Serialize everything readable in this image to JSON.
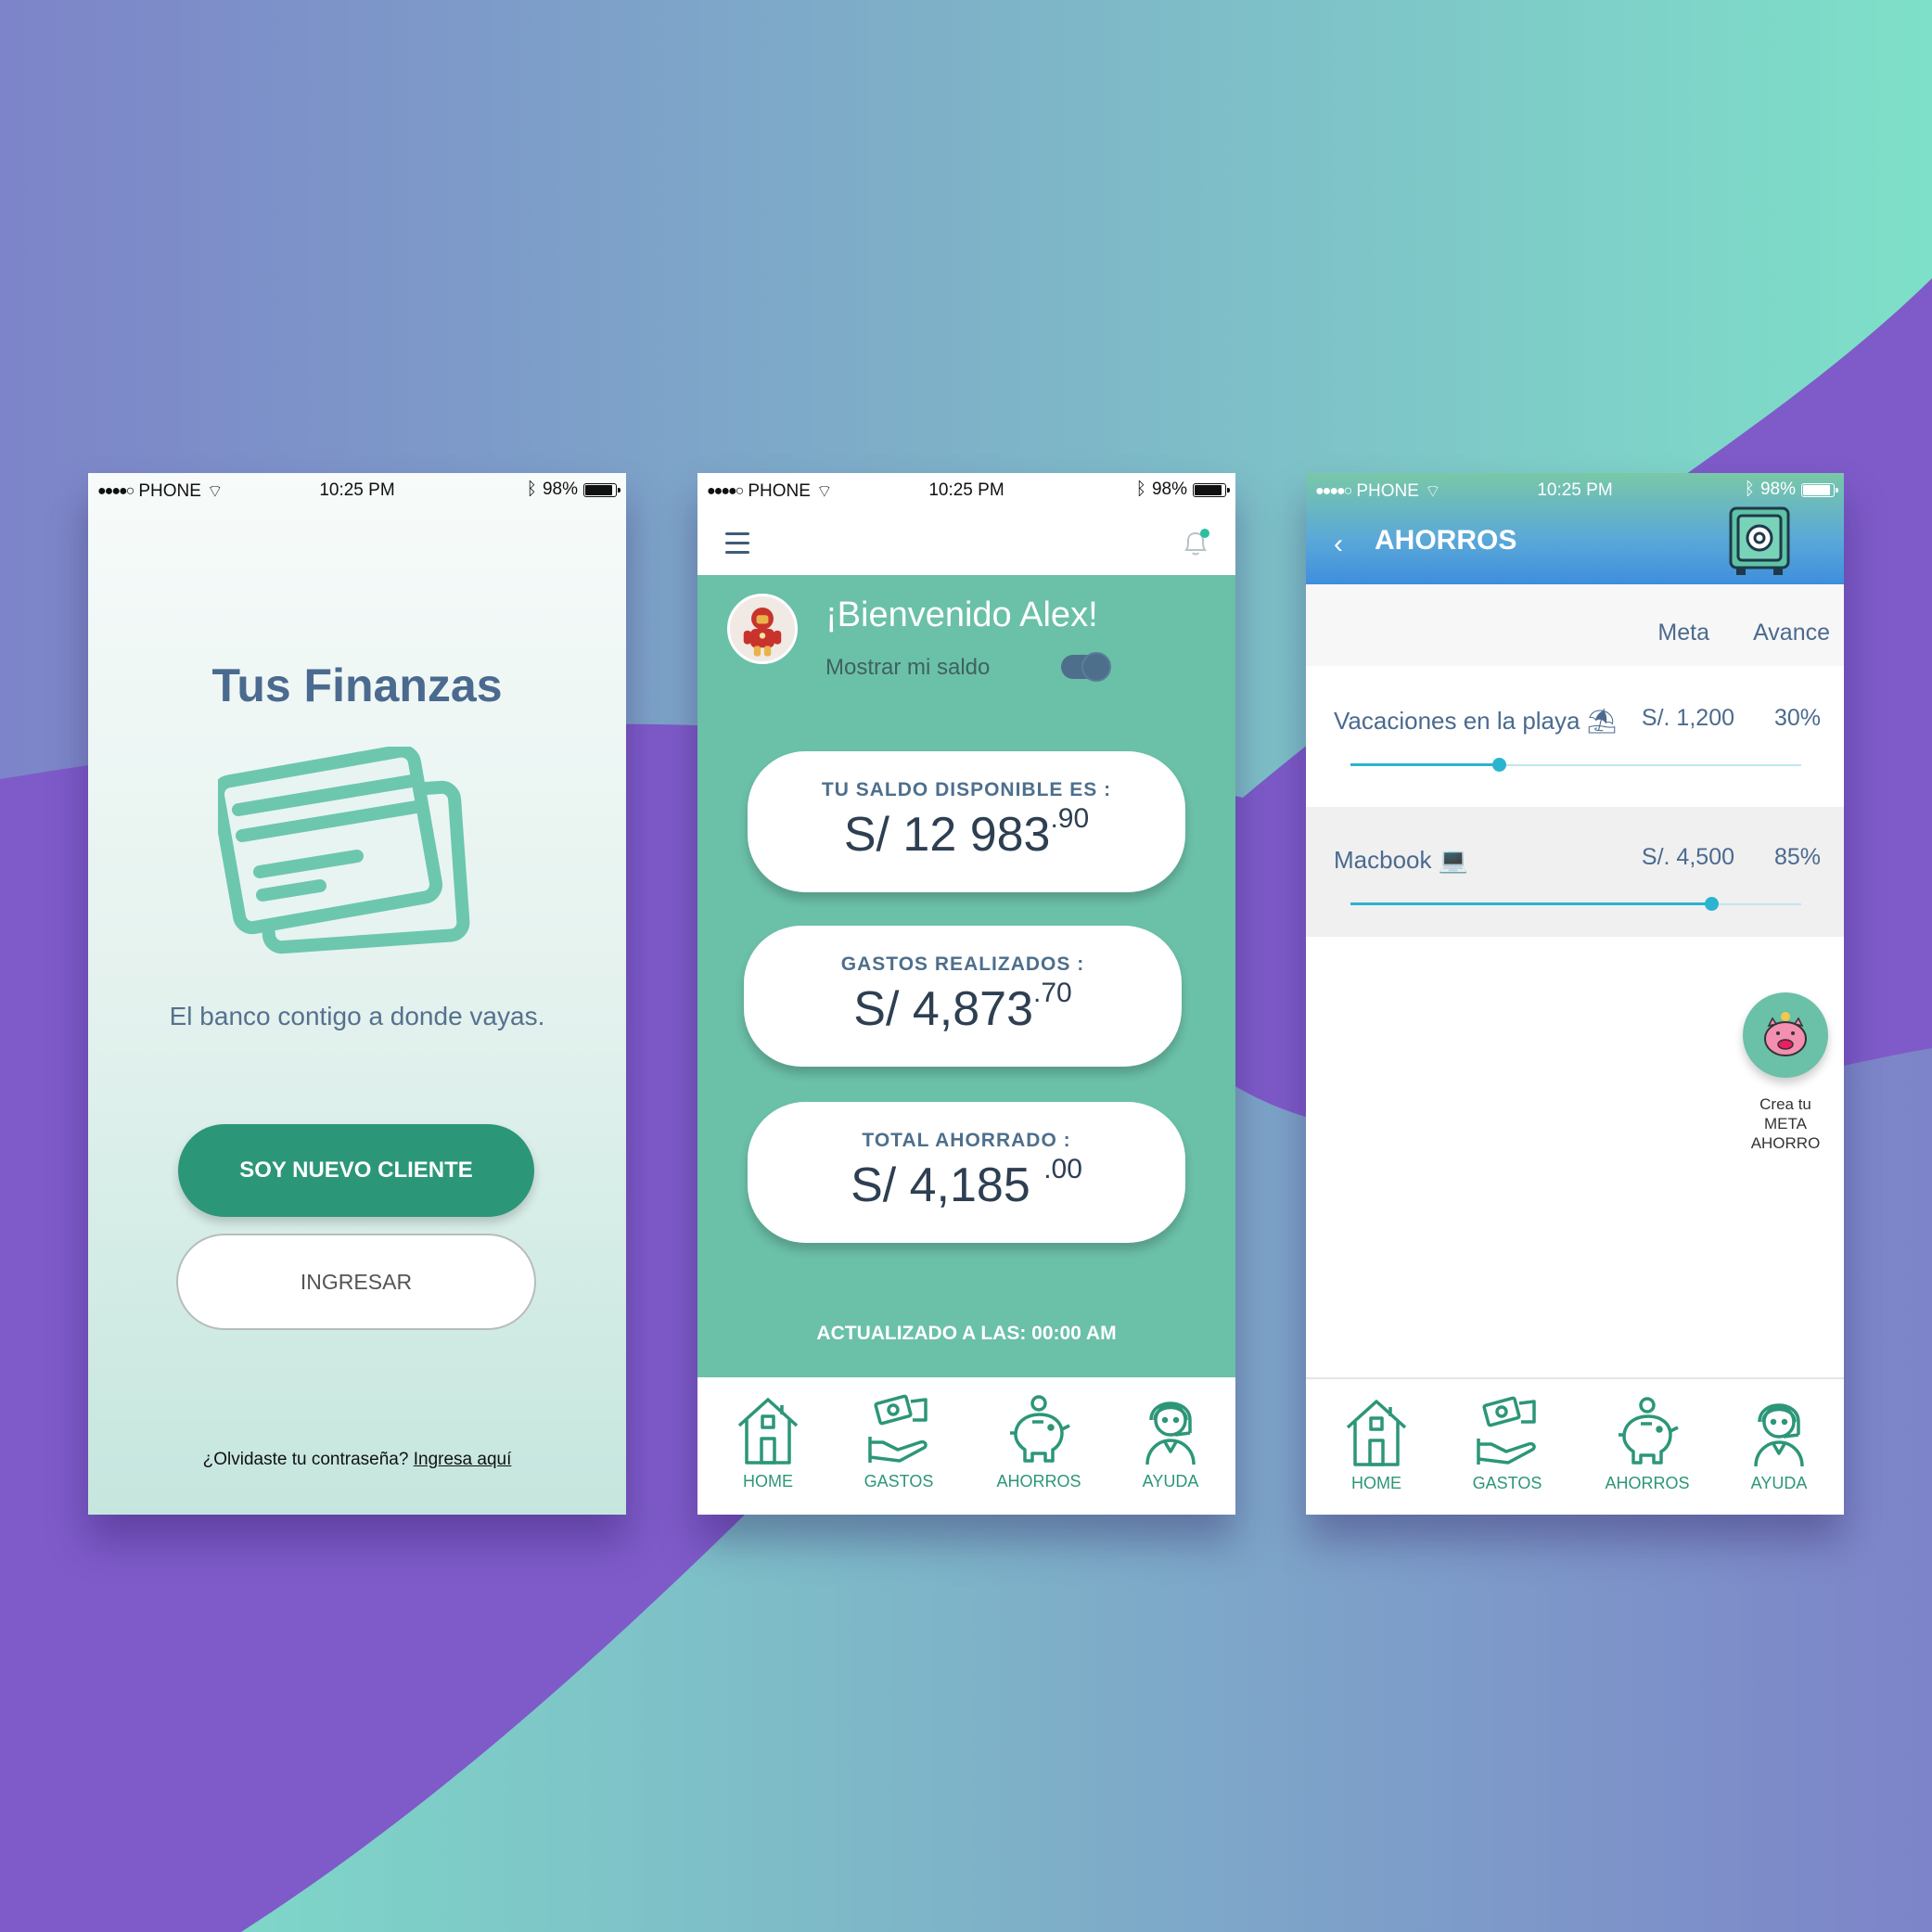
{
  "statusbar": {
    "carrier": "PHONE",
    "time": "10:25 PM",
    "battery": "98%"
  },
  "colors": {
    "accent_green": "#2C9678",
    "mint": "#6BC0A8",
    "slate_blue": "#4B6A8F",
    "bg_purple": "#7E5BC9",
    "bg_teal": "#7EE2C8"
  },
  "login": {
    "title": "Tus Finanzas",
    "tagline": "El banco contigo a donde vayas.",
    "new_client_label": "SOY NUEVO CLIENTE",
    "login_label": "INGRESAR",
    "forgot_text": "¿Olvidaste tu contraseña?",
    "forgot_link": "Ingresa aquí",
    "icon": "credit-cards-icon"
  },
  "home": {
    "welcome": "¡Bienvenido Alex!",
    "show_balance_label": "Mostrar mi saldo",
    "cards": [
      {
        "title": "TU SALDO DISPONIBLE ES :",
        "amount": "S/ 12 983",
        "cents": ".90"
      },
      {
        "title": "GASTOS REALIZADOS :",
        "amount": "S/ 4,873",
        "cents": ".70"
      },
      {
        "title": "TOTAL AHORRADO :",
        "amount": "S/ 4,185 ",
        "cents": ".00"
      }
    ],
    "updated": "ACTUALIZADO A LAS: 00:00 AM"
  },
  "nav": [
    {
      "label": "HOME",
      "icon": "home-icon"
    },
    {
      "label": "GASTOS",
      "icon": "money-hand-icon"
    },
    {
      "label": "AHORROS",
      "icon": "piggy-bank-icon"
    },
    {
      "label": "AYUDA",
      "icon": "support-agent-icon"
    }
  ],
  "savings": {
    "title": "AHORROS",
    "col_meta": "Meta",
    "col_avance": "Avance",
    "goals": [
      {
        "name": "Vacaciones en la playa",
        "icon": "beach-icon",
        "meta": "S/. 1,200",
        "avance": "30%",
        "progress": 0.33
      },
      {
        "name": "Macbook",
        "icon": "laptop-icon",
        "meta": "S/. 4,500",
        "avance": "85%",
        "progress": 0.8
      }
    ],
    "fab_line1": "Crea tu",
    "fab_line2": "META",
    "fab_line3": "AHORRO"
  }
}
